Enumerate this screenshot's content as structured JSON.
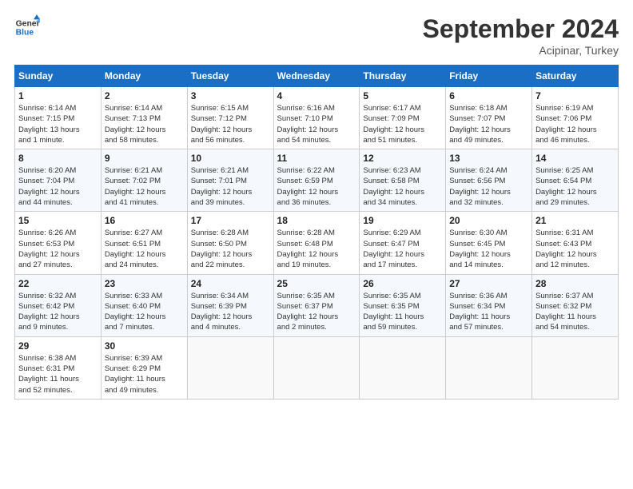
{
  "logo": {
    "line1": "General",
    "line2": "Blue"
  },
  "title": "September 2024",
  "location": "Acipinar, Turkey",
  "days_header": [
    "Sunday",
    "Monday",
    "Tuesday",
    "Wednesday",
    "Thursday",
    "Friday",
    "Saturday"
  ],
  "weeks": [
    [
      {
        "day": "1",
        "info": "Sunrise: 6:14 AM\nSunset: 7:15 PM\nDaylight: 13 hours\nand 1 minute."
      },
      {
        "day": "2",
        "info": "Sunrise: 6:14 AM\nSunset: 7:13 PM\nDaylight: 12 hours\nand 58 minutes."
      },
      {
        "day": "3",
        "info": "Sunrise: 6:15 AM\nSunset: 7:12 PM\nDaylight: 12 hours\nand 56 minutes."
      },
      {
        "day": "4",
        "info": "Sunrise: 6:16 AM\nSunset: 7:10 PM\nDaylight: 12 hours\nand 54 minutes."
      },
      {
        "day": "5",
        "info": "Sunrise: 6:17 AM\nSunset: 7:09 PM\nDaylight: 12 hours\nand 51 minutes."
      },
      {
        "day": "6",
        "info": "Sunrise: 6:18 AM\nSunset: 7:07 PM\nDaylight: 12 hours\nand 49 minutes."
      },
      {
        "day": "7",
        "info": "Sunrise: 6:19 AM\nSunset: 7:06 PM\nDaylight: 12 hours\nand 46 minutes."
      }
    ],
    [
      {
        "day": "8",
        "info": "Sunrise: 6:20 AM\nSunset: 7:04 PM\nDaylight: 12 hours\nand 44 minutes."
      },
      {
        "day": "9",
        "info": "Sunrise: 6:21 AM\nSunset: 7:02 PM\nDaylight: 12 hours\nand 41 minutes."
      },
      {
        "day": "10",
        "info": "Sunrise: 6:21 AM\nSunset: 7:01 PM\nDaylight: 12 hours\nand 39 minutes."
      },
      {
        "day": "11",
        "info": "Sunrise: 6:22 AM\nSunset: 6:59 PM\nDaylight: 12 hours\nand 36 minutes."
      },
      {
        "day": "12",
        "info": "Sunrise: 6:23 AM\nSunset: 6:58 PM\nDaylight: 12 hours\nand 34 minutes."
      },
      {
        "day": "13",
        "info": "Sunrise: 6:24 AM\nSunset: 6:56 PM\nDaylight: 12 hours\nand 32 minutes."
      },
      {
        "day": "14",
        "info": "Sunrise: 6:25 AM\nSunset: 6:54 PM\nDaylight: 12 hours\nand 29 minutes."
      }
    ],
    [
      {
        "day": "15",
        "info": "Sunrise: 6:26 AM\nSunset: 6:53 PM\nDaylight: 12 hours\nand 27 minutes."
      },
      {
        "day": "16",
        "info": "Sunrise: 6:27 AM\nSunset: 6:51 PM\nDaylight: 12 hours\nand 24 minutes."
      },
      {
        "day": "17",
        "info": "Sunrise: 6:28 AM\nSunset: 6:50 PM\nDaylight: 12 hours\nand 22 minutes."
      },
      {
        "day": "18",
        "info": "Sunrise: 6:28 AM\nSunset: 6:48 PM\nDaylight: 12 hours\nand 19 minutes."
      },
      {
        "day": "19",
        "info": "Sunrise: 6:29 AM\nSunset: 6:47 PM\nDaylight: 12 hours\nand 17 minutes."
      },
      {
        "day": "20",
        "info": "Sunrise: 6:30 AM\nSunset: 6:45 PM\nDaylight: 12 hours\nand 14 minutes."
      },
      {
        "day": "21",
        "info": "Sunrise: 6:31 AM\nSunset: 6:43 PM\nDaylight: 12 hours\nand 12 minutes."
      }
    ],
    [
      {
        "day": "22",
        "info": "Sunrise: 6:32 AM\nSunset: 6:42 PM\nDaylight: 12 hours\nand 9 minutes."
      },
      {
        "day": "23",
        "info": "Sunrise: 6:33 AM\nSunset: 6:40 PM\nDaylight: 12 hours\nand 7 minutes."
      },
      {
        "day": "24",
        "info": "Sunrise: 6:34 AM\nSunset: 6:39 PM\nDaylight: 12 hours\nand 4 minutes."
      },
      {
        "day": "25",
        "info": "Sunrise: 6:35 AM\nSunset: 6:37 PM\nDaylight: 12 hours\nand 2 minutes."
      },
      {
        "day": "26",
        "info": "Sunrise: 6:35 AM\nSunset: 6:35 PM\nDaylight: 11 hours\nand 59 minutes."
      },
      {
        "day": "27",
        "info": "Sunrise: 6:36 AM\nSunset: 6:34 PM\nDaylight: 11 hours\nand 57 minutes."
      },
      {
        "day": "28",
        "info": "Sunrise: 6:37 AM\nSunset: 6:32 PM\nDaylight: 11 hours\nand 54 minutes."
      }
    ],
    [
      {
        "day": "29",
        "info": "Sunrise: 6:38 AM\nSunset: 6:31 PM\nDaylight: 11 hours\nand 52 minutes."
      },
      {
        "day": "30",
        "info": "Sunrise: 6:39 AM\nSunset: 6:29 PM\nDaylight: 11 hours\nand 49 minutes."
      },
      {
        "day": "",
        "info": ""
      },
      {
        "day": "",
        "info": ""
      },
      {
        "day": "",
        "info": ""
      },
      {
        "day": "",
        "info": ""
      },
      {
        "day": "",
        "info": ""
      }
    ]
  ]
}
